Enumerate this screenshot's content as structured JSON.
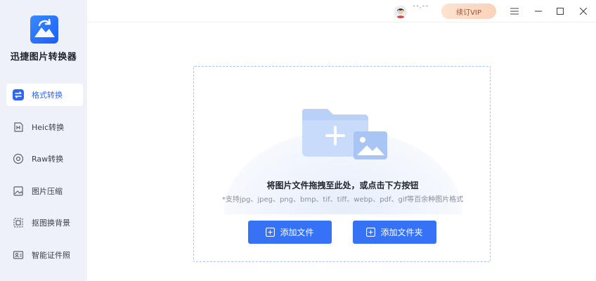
{
  "app": {
    "name": "迅捷图片转换器"
  },
  "sidebar": {
    "items": [
      {
        "label": "格式转换",
        "icon": "format-convert-icon",
        "active": true
      },
      {
        "label": "Heic转换",
        "icon": "heic-icon",
        "active": false
      },
      {
        "label": "Raw转换",
        "icon": "raw-icon",
        "active": false
      },
      {
        "label": "图片压缩",
        "icon": "image-compress-icon",
        "active": false
      },
      {
        "label": "抠图换背景",
        "icon": "cutout-icon",
        "active": false
      },
      {
        "label": "智能证件照",
        "icon": "id-photo-icon",
        "active": false
      }
    ]
  },
  "titlebar": {
    "username": "¯¯·¯¯",
    "vip_label": "续订VIP",
    "buttons": [
      "menu-icon",
      "minimize-icon",
      "maximize-icon",
      "close-icon"
    ]
  },
  "dropzone": {
    "title": "将图片文件拖拽至此处，或点击下方按钮",
    "subtitle": "*支持jpg、jpeg、png、bmp、tif、tiff、webp、pdf、gif等百余种图片格式",
    "add_file_label": "添加文件",
    "add_folder_label": "添加文件夹"
  },
  "colors": {
    "accent": "#3672f6",
    "active_text": "#2f66f0",
    "vip_bg": "#f9d2bb",
    "vip_text": "#a1512a"
  }
}
